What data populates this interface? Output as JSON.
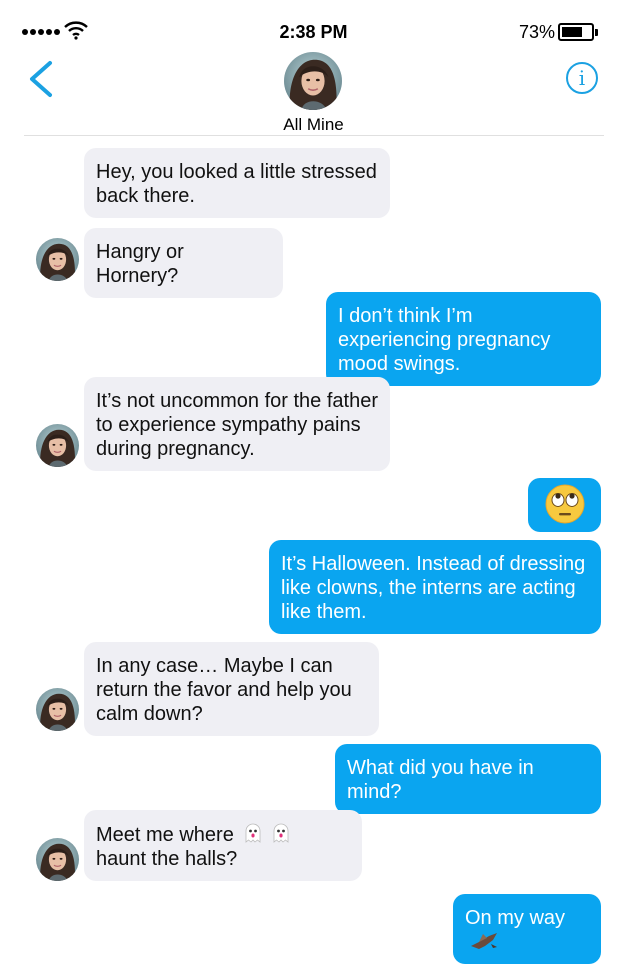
{
  "status": {
    "time": "2:38 PM",
    "battery": "73%",
    "battery_level": 0.73
  },
  "header": {
    "contact_name": "All Mine",
    "info_label": "i"
  },
  "messages": [
    {
      "dir": "in",
      "text": "Hey, you looked a little stressed back there."
    },
    {
      "dir": "in",
      "text": "Hangry or Hornery?"
    },
    {
      "dir": "out",
      "text": "I don’t think I’m experiencing pregnancy mood swings."
    },
    {
      "dir": "in",
      "text": "It’s not uncommon for the father to experience sympathy pains during pregnancy."
    },
    {
      "dir": "out",
      "emoji": "eye-roll-emoji"
    },
    {
      "dir": "out",
      "text": "It’s Halloween. Instead of dressing like clowns, the interns are acting like them."
    },
    {
      "dir": "in",
      "text": "In any case… Maybe I can return the favor and help you calm down?"
    },
    {
      "dir": "out",
      "text": "What did you have in mind?"
    },
    {
      "dir": "in",
      "text_before": "Meet me where",
      "text_after": "haunt the halls?",
      "emoji": "ghost-emoji"
    },
    {
      "dir": "out",
      "text": "On my way",
      "emoji": "bird-emoji"
    }
  ],
  "colors": {
    "accent": "#1ba1e2",
    "outgoing": "#0aa5f0",
    "incoming": "#efeff4"
  }
}
